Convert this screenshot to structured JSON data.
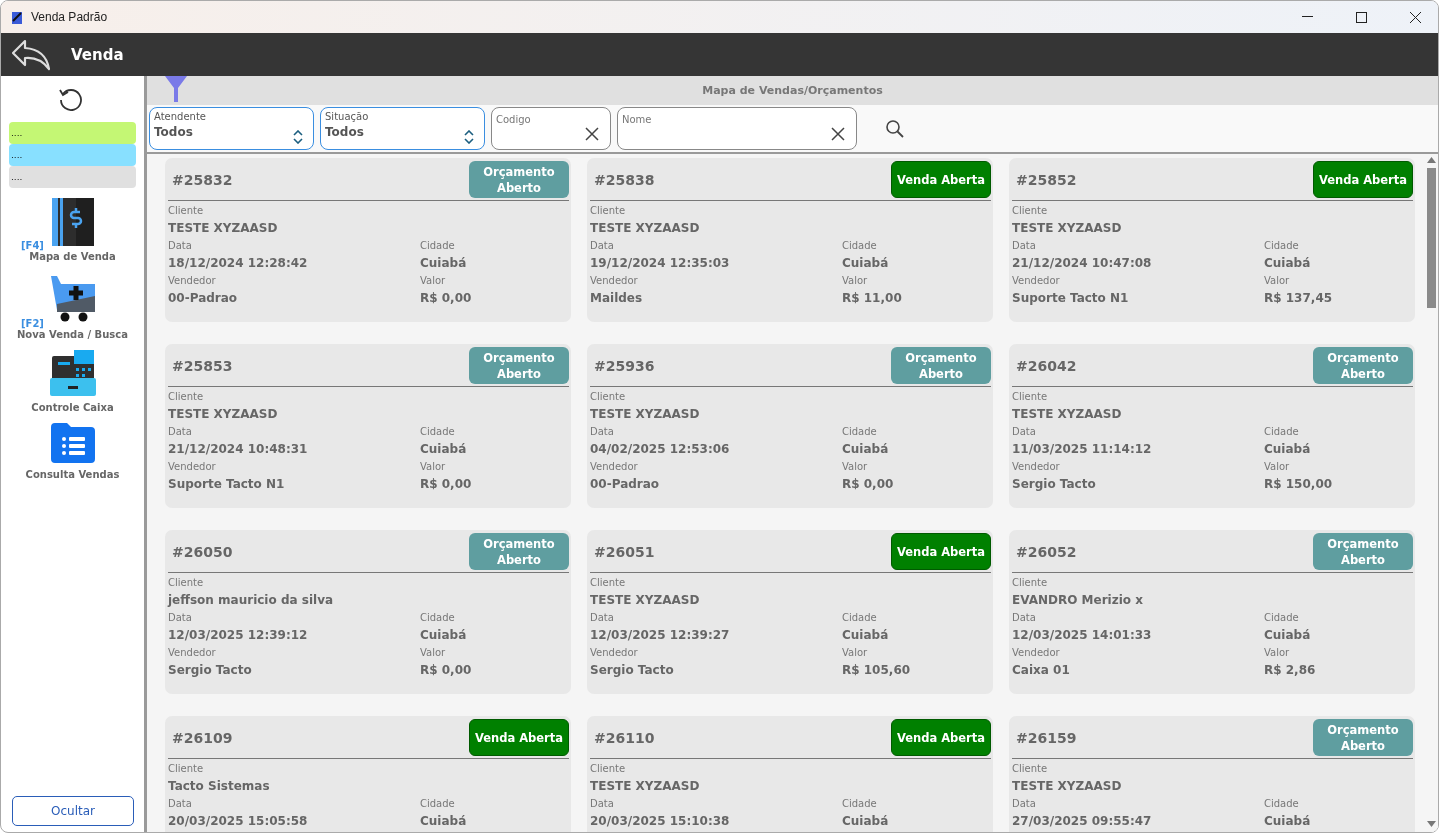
{
  "window": {
    "title": "Venda Padrão"
  },
  "header": {
    "title": "Venda"
  },
  "sidebar": {
    "legend": [
      {
        "text": "....",
        "color": "#c4f774"
      },
      {
        "text": "....",
        "color": "#88e0ff"
      },
      {
        "text": "....",
        "color": "#e0e0e0"
      }
    ],
    "items": [
      {
        "kind": "map",
        "shortcut": "[F4]",
        "label": "Mapa de Venda"
      },
      {
        "kind": "cart",
        "shortcut": "[F2]",
        "label": "Nova Venda / Busca"
      },
      {
        "kind": "register",
        "label": "Controle Caixa"
      },
      {
        "kind": "list",
        "label": "Consulta Vendas"
      }
    ],
    "hide_button": "Ocultar"
  },
  "panel_title": "Mapa de Vendas/Orçamentos",
  "filters": {
    "atendente": {
      "label": "Atendente",
      "value": "Todos"
    },
    "situacao": {
      "label": "Situação",
      "value": "Todos"
    },
    "codigo": {
      "placeholder": "Codigo"
    },
    "nome": {
      "placeholder": "Nome"
    }
  },
  "cards": [
    {
      "code": "#25832",
      "status": {
        "kind": "quote",
        "text": "Orçamento Aberto"
      },
      "cliente": {
        "label": "Cliente",
        "value": "TESTE XYZAASD"
      },
      "data": {
        "label": "Data",
        "value": "18/12/2024 12:28:42"
      },
      "cidade": {
        "label": "Cidade",
        "value": "Cuiabá"
      },
      "vendedor": {
        "label": "Vendedor",
        "value": "00-Padrao"
      },
      "valor": {
        "label": "Valor",
        "value": "R$ 0,00"
      }
    },
    {
      "code": "#25838",
      "status": {
        "kind": "sale",
        "text": "Venda Aberta"
      },
      "cliente": {
        "label": "Cliente",
        "value": "TESTE XYZAASD"
      },
      "data": {
        "label": "Data",
        "value": "19/12/2024 12:35:03"
      },
      "cidade": {
        "label": "Cidade",
        "value": "Cuiabá"
      },
      "vendedor": {
        "label": "Vendedor",
        "value": "Maildes"
      },
      "valor": {
        "label": "Valor",
        "value": "R$ 11,00"
      }
    },
    {
      "code": "#25852",
      "status": {
        "kind": "sale",
        "text": "Venda Aberta"
      },
      "cliente": {
        "label": "Cliente",
        "value": "TESTE XYZAASD"
      },
      "data": {
        "label": "Data",
        "value": "21/12/2024 10:47:08"
      },
      "cidade": {
        "label": "Cidade",
        "value": "Cuiabá"
      },
      "vendedor": {
        "label": "Vendedor",
        "value": "Suporte Tacto N1"
      },
      "valor": {
        "label": "Valor",
        "value": "R$ 137,45"
      }
    },
    {
      "code": "#25853",
      "status": {
        "kind": "quote",
        "text": "Orçamento Aberto"
      },
      "cliente": {
        "label": "Cliente",
        "value": "TESTE XYZAASD"
      },
      "data": {
        "label": "Data",
        "value": "21/12/2024 10:48:31"
      },
      "cidade": {
        "label": "Cidade",
        "value": "Cuiabá"
      },
      "vendedor": {
        "label": "Vendedor",
        "value": "Suporte Tacto N1"
      },
      "valor": {
        "label": "Valor",
        "value": "R$ 0,00"
      }
    },
    {
      "code": "#25936",
      "status": {
        "kind": "quote",
        "text": "Orçamento Aberto"
      },
      "cliente": {
        "label": "Cliente",
        "value": "TESTE XYZAASD"
      },
      "data": {
        "label": "Data",
        "value": "04/02/2025 12:53:06"
      },
      "cidade": {
        "label": "Cidade",
        "value": "Cuiabá"
      },
      "vendedor": {
        "label": "Vendedor",
        "value": "00-Padrao"
      },
      "valor": {
        "label": "Valor",
        "value": "R$ 0,00"
      }
    },
    {
      "code": "#26042",
      "status": {
        "kind": "quote",
        "text": "Orçamento Aberto"
      },
      "cliente": {
        "label": "Cliente",
        "value": "TESTE XYZAASD"
      },
      "data": {
        "label": "Data",
        "value": "11/03/2025 11:14:12"
      },
      "cidade": {
        "label": "Cidade",
        "value": "Cuiabá"
      },
      "vendedor": {
        "label": "Vendedor",
        "value": "Sergio Tacto"
      },
      "valor": {
        "label": "Valor",
        "value": "R$ 150,00"
      }
    },
    {
      "code": "#26050",
      "status": {
        "kind": "quote",
        "text": "Orçamento Aberto"
      },
      "cliente": {
        "label": "Cliente",
        "value": "jeffson mauricio da silva"
      },
      "data": {
        "label": "Data",
        "value": "12/03/2025 12:39:12"
      },
      "cidade": {
        "label": "Cidade",
        "value": "Cuiabá"
      },
      "vendedor": {
        "label": "Vendedor",
        "value": "Sergio Tacto"
      },
      "valor": {
        "label": "Valor",
        "value": "R$ 0,00"
      }
    },
    {
      "code": "#26051",
      "status": {
        "kind": "sale",
        "text": "Venda Aberta"
      },
      "cliente": {
        "label": "Cliente",
        "value": "TESTE XYZAASD"
      },
      "data": {
        "label": "Data",
        "value": "12/03/2025 12:39:27"
      },
      "cidade": {
        "label": "Cidade",
        "value": "Cuiabá"
      },
      "vendedor": {
        "label": "Vendedor",
        "value": "Sergio Tacto"
      },
      "valor": {
        "label": "Valor",
        "value": "R$ 105,60"
      }
    },
    {
      "code": "#26052",
      "status": {
        "kind": "quote",
        "text": "Orçamento Aberto"
      },
      "cliente": {
        "label": "Cliente",
        "value": "EVANDRO Merizio x"
      },
      "data": {
        "label": "Data",
        "value": "12/03/2025 14:01:33"
      },
      "cidade": {
        "label": "Cidade",
        "value": "Cuiabá"
      },
      "vendedor": {
        "label": "Vendedor",
        "value": "Caixa 01"
      },
      "valor": {
        "label": "Valor",
        "value": "R$ 2,86"
      }
    },
    {
      "code": "#26109",
      "status": {
        "kind": "sale",
        "text": "Venda Aberta"
      },
      "cliente": {
        "label": "Cliente",
        "value": "Tacto Sistemas"
      },
      "data": {
        "label": "Data",
        "value": "20/03/2025 15:05:58"
      },
      "cidade": {
        "label": "Cidade",
        "value": "Cuiabá"
      }
    },
    {
      "code": "#26110",
      "status": {
        "kind": "sale",
        "text": "Venda Aberta"
      },
      "cliente": {
        "label": "Cliente",
        "value": "TESTE XYZAASD"
      },
      "data": {
        "label": "Data",
        "value": "20/03/2025 15:10:38"
      },
      "cidade": {
        "label": "Cidade",
        "value": "Cuiabá"
      }
    },
    {
      "code": "#26159",
      "status": {
        "kind": "quote",
        "text": "Orçamento Aberto"
      },
      "cliente": {
        "label": "Cliente",
        "value": "TESTE XYZAASD"
      },
      "data": {
        "label": "Data",
        "value": "27/03/2025 09:55:47"
      },
      "cidade": {
        "label": "Cidade",
        "value": "Cuiabá"
      }
    }
  ]
}
